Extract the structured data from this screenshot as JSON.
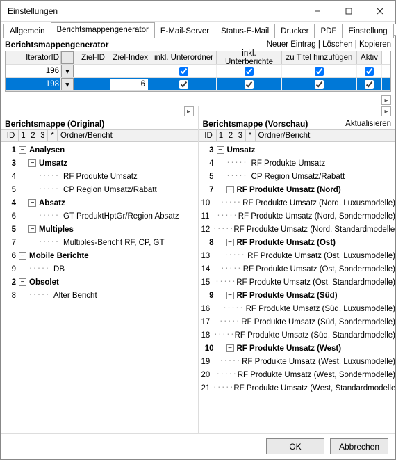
{
  "window": {
    "title": "Einstellungen"
  },
  "tabs": {
    "items": [
      "Allgemein",
      "Berichtsmappengenerator",
      "E-Mail-Server",
      "Status-E-Mail",
      "Drucker",
      "PDF",
      "Einstellung"
    ],
    "active_index": 1
  },
  "generator": {
    "title": "Berichtsmappengenerator",
    "links": {
      "new": "Neuer Eintrag",
      "delete": "Löschen",
      "copy": "Kopieren"
    },
    "columns": {
      "iterator": "IteratorID",
      "zielid": "Ziel-ID",
      "zielindex": "Ziel-Index",
      "unterordner": "inkl. Unterordner",
      "unterberichte": "inkl. Unterberichte",
      "titel": "zu Titel hinzufügen",
      "aktiv": "Aktiv"
    },
    "rows": [
      {
        "iterator": "196",
        "zielid": "",
        "zielindex": "",
        "unterordner": true,
        "unterberichte": true,
        "titel": true,
        "aktiv": true,
        "selected": false
      },
      {
        "iterator": "198",
        "zielid": "",
        "zielindex": "6",
        "unterordner": true,
        "unterberichte": true,
        "titel": true,
        "aktiv": true,
        "selected": true
      }
    ]
  },
  "original": {
    "title": "Berichtsmappe (Original)",
    "headers": {
      "id": "ID",
      "c1": "1",
      "c2": "2",
      "c3": "3",
      "star": "*",
      "ob": "Ordner/Bericht"
    },
    "rows": [
      {
        "id": "1",
        "depth": 0,
        "expander": "-",
        "bold": true,
        "label": "Analysen"
      },
      {
        "id": "3",
        "depth": 1,
        "expander": "-",
        "bold": true,
        "label": "Umsatz"
      },
      {
        "id": "4",
        "depth": 2,
        "expander": "",
        "bold": false,
        "label": "RF Produkte Umsatz"
      },
      {
        "id": "5",
        "depth": 2,
        "expander": "",
        "bold": false,
        "label": "CP Region Umsatz/Rabatt"
      },
      {
        "id": "4",
        "depth": 1,
        "expander": "-",
        "bold": true,
        "label": "Absatz"
      },
      {
        "id": "6",
        "depth": 2,
        "expander": "",
        "bold": false,
        "label": "GT ProduktHptGr/Region Absatz"
      },
      {
        "id": "5",
        "depth": 1,
        "expander": "-",
        "bold": true,
        "label": "Multiples"
      },
      {
        "id": "7",
        "depth": 2,
        "expander": "",
        "bold": false,
        "label": "Multiples-Bericht RF, CP, GT"
      },
      {
        "id": "6",
        "depth": 0,
        "expander": "-",
        "bold": true,
        "label": "Mobile Berichte"
      },
      {
        "id": "9",
        "depth": 1,
        "expander": "",
        "bold": false,
        "label": "DB"
      },
      {
        "id": "2",
        "depth": 0,
        "expander": "-",
        "bold": true,
        "label": "Obsolet"
      },
      {
        "id": "8",
        "depth": 1,
        "expander": "",
        "bold": false,
        "label": "Alter Bericht"
      }
    ]
  },
  "preview": {
    "title": "Berichtsmappe (Vorschau)",
    "refresh": "Aktualisieren",
    "headers": {
      "id": "ID",
      "c1": "1",
      "c2": "2",
      "c3": "3",
      "star": "*",
      "ob": "Ordner/Bericht"
    },
    "rows": [
      {
        "id": "3",
        "depth": 0,
        "expander": "-",
        "bold": true,
        "label": "Umsatz"
      },
      {
        "id": "4",
        "depth": 1,
        "expander": "",
        "bold": false,
        "label": "RF Produkte Umsatz"
      },
      {
        "id": "5",
        "depth": 1,
        "expander": "",
        "bold": false,
        "label": "CP Region Umsatz/Rabatt"
      },
      {
        "id": "7",
        "depth": 1,
        "expander": "-",
        "bold": true,
        "label": "RF Produkte Umsatz (Nord)"
      },
      {
        "id": "10",
        "depth": 2,
        "expander": "",
        "bold": false,
        "label": "RF Produkte Umsatz (Nord, Luxusmodelle)"
      },
      {
        "id": "11",
        "depth": 2,
        "expander": "",
        "bold": false,
        "label": "RF Produkte Umsatz (Nord, Sondermodelle)"
      },
      {
        "id": "12",
        "depth": 2,
        "expander": "",
        "bold": false,
        "label": "RF Produkte Umsatz (Nord, Standardmodelle)"
      },
      {
        "id": "8",
        "depth": 1,
        "expander": "-",
        "bold": true,
        "label": "RF Produkte Umsatz (Ost)"
      },
      {
        "id": "13",
        "depth": 2,
        "expander": "",
        "bold": false,
        "label": "RF Produkte Umsatz (Ost, Luxusmodelle)"
      },
      {
        "id": "14",
        "depth": 2,
        "expander": "",
        "bold": false,
        "label": "RF Produkte Umsatz (Ost, Sondermodelle)"
      },
      {
        "id": "15",
        "depth": 2,
        "expander": "",
        "bold": false,
        "label": "RF Produkte Umsatz (Ost, Standardmodelle)"
      },
      {
        "id": "9",
        "depth": 1,
        "expander": "-",
        "bold": true,
        "label": "RF Produkte Umsatz (Süd)"
      },
      {
        "id": "16",
        "depth": 2,
        "expander": "",
        "bold": false,
        "label": "RF Produkte Umsatz (Süd, Luxusmodelle)"
      },
      {
        "id": "17",
        "depth": 2,
        "expander": "",
        "bold": false,
        "label": "RF Produkte Umsatz (Süd, Sondermodelle)"
      },
      {
        "id": "18",
        "depth": 2,
        "expander": "",
        "bold": false,
        "label": "RF Produkte Umsatz (Süd, Standardmodelle)"
      },
      {
        "id": "10",
        "depth": 1,
        "expander": "-",
        "bold": true,
        "label": "RF Produkte Umsatz (West)"
      },
      {
        "id": "19",
        "depth": 2,
        "expander": "",
        "bold": false,
        "label": "RF Produkte Umsatz (West, Luxusmodelle)"
      },
      {
        "id": "20",
        "depth": 2,
        "expander": "",
        "bold": false,
        "label": "RF Produkte Umsatz (West, Sondermodelle)"
      },
      {
        "id": "21",
        "depth": 2,
        "expander": "",
        "bold": false,
        "label": "RF Produkte Umsatz (West, Standardmodelle)"
      }
    ]
  },
  "footer": {
    "ok": "OK",
    "cancel": "Abbrechen"
  }
}
